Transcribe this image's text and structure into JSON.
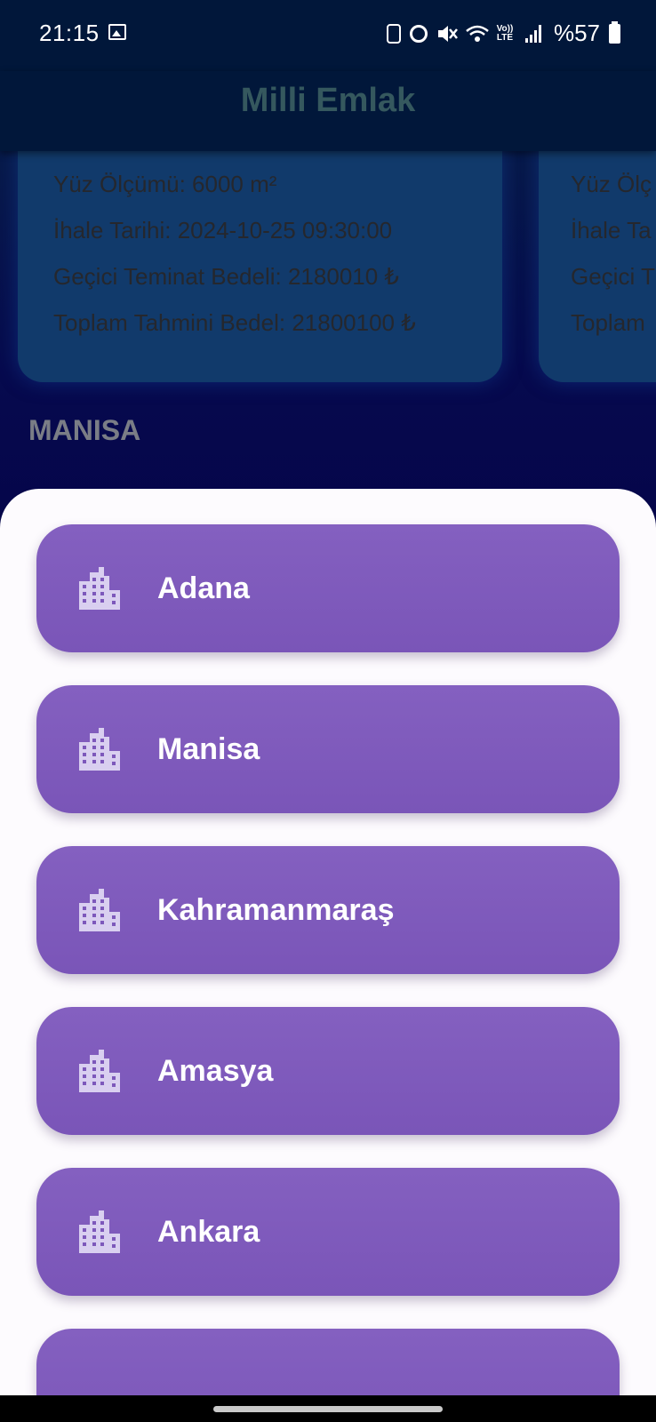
{
  "status_bar": {
    "time": "21:15",
    "battery_text": "%57",
    "lte_label": "Vo)) LTE"
  },
  "app_bar": {
    "title": "Milli Emlak"
  },
  "cards": [
    {
      "lines": [
        "Yüz Ölçümü: 6000 m²",
        "İhale Tarihi: 2024-10-25 09:30:00",
        "Geçici Teminat Bedeli: 2180010 ₺",
        "Toplam Tahmini Bedel: 21800100 ₺"
      ]
    },
    {
      "lines": [
        "Yüz Ölç",
        "İhale Ta",
        "Geçici T",
        "Toplam"
      ]
    }
  ],
  "section_title": "MANISA",
  "city_sheet": {
    "icon": "building-icon",
    "items": [
      "Adana",
      "Manisa",
      "Kahramanmaraş",
      "Amasya",
      "Ankara",
      ""
    ]
  },
  "colors": {
    "app_bar_bg": "#01173a",
    "title": "#35585e",
    "card_bg": "#113a6b",
    "button_bg": "#7d58bb",
    "sheet_bg": "#fdfbfe",
    "icon_fill": "#d9cff0"
  }
}
